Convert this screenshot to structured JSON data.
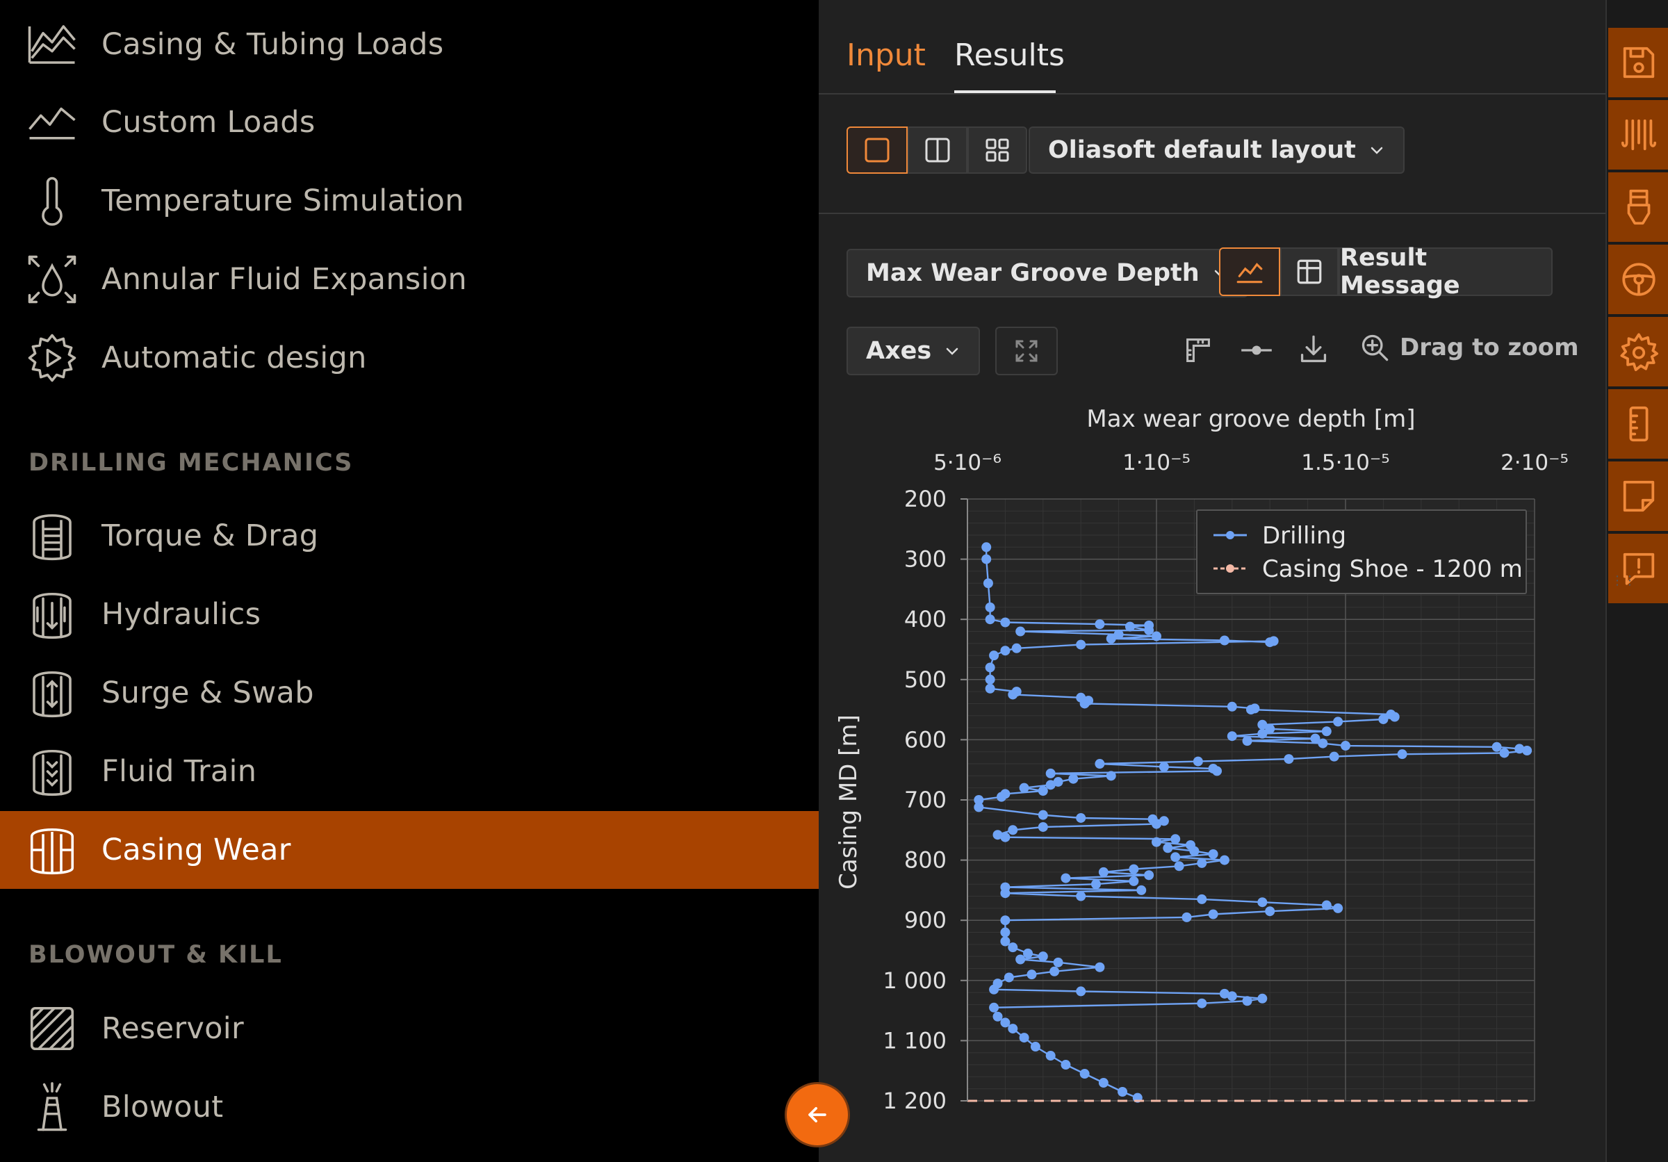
{
  "sidebar": {
    "items": [
      {
        "label": "Casing & Tubing Loads",
        "icon": "loads-chart-icon"
      },
      {
        "label": "Custom Loads",
        "icon": "line-chart-icon"
      },
      {
        "label": "Temperature Simulation",
        "icon": "thermometer-icon"
      },
      {
        "label": "Annular Fluid Expansion",
        "icon": "droplet-expand-icon"
      },
      {
        "label": "Automatic design",
        "icon": "gear-play-icon"
      }
    ],
    "sections": [
      {
        "title": "DRILLING MECHANICS",
        "items": [
          {
            "label": "Torque & Drag",
            "icon": "torque-drag-icon"
          },
          {
            "label": "Hydraulics",
            "icon": "hydraulics-icon"
          },
          {
            "label": "Surge & Swab",
            "icon": "surge-swab-icon"
          },
          {
            "label": "Fluid Train",
            "icon": "fluid-train-icon"
          },
          {
            "label": "Casing Wear",
            "icon": "casing-wear-icon",
            "active": true
          }
        ]
      },
      {
        "title": "BLOWOUT & KILL",
        "items": [
          {
            "label": "Reservoir",
            "icon": "hatched-square-icon"
          },
          {
            "label": "Blowout",
            "icon": "blowout-rig-icon"
          }
        ]
      }
    ]
  },
  "tabs": {
    "input": "Input",
    "results": "Results",
    "active": "results"
  },
  "layout": {
    "dropdown": "Oliasoft default layout"
  },
  "result_controls": {
    "metric": "Max Wear Groove Depth",
    "message_button": "Result Message",
    "axes": "Axes",
    "drag_zoom": "Drag to zoom"
  },
  "colors": {
    "accent": "#f0893a",
    "active_nav": "#a84300",
    "series_drilling": "#6fa3f5",
    "series_shoe": "#f4b9a6"
  },
  "chart_data": {
    "type": "line",
    "title": "",
    "xlabel": "Max wear groove depth [m]",
    "ylabel": "Casing MD [m]",
    "xlim": [
      5e-06,
      2e-05
    ],
    "ylim": [
      200,
      1200
    ],
    "x_ticks": [
      "5·10⁻⁶",
      "1·10⁻⁵",
      "1.5·10⁻⁵",
      "2·10⁻⁵"
    ],
    "y_ticks": [
      "200",
      "300",
      "400",
      "500",
      "600",
      "700",
      "800",
      "900",
      "1 000",
      "1 100",
      "1 200"
    ],
    "legend_position": "top-right",
    "grid": true,
    "series": [
      {
        "name": "Drilling",
        "points": [
          [
            5.5e-06,
            280
          ],
          [
            5.5e-06,
            300
          ],
          [
            5.55e-06,
            340
          ],
          [
            5.6e-06,
            380
          ],
          [
            5.6e-06,
            400
          ],
          [
            6e-06,
            405
          ],
          [
            8.5e-06,
            408
          ],
          [
            9.8e-06,
            410
          ],
          [
            9.3e-06,
            412
          ],
          [
            9.8e-06,
            418
          ],
          [
            6.4e-06,
            420
          ],
          [
            9e-06,
            425
          ],
          [
            1e-05,
            428
          ],
          [
            8.8e-06,
            432
          ],
          [
            1.18e-05,
            435
          ],
          [
            1.3e-05,
            438
          ],
          [
            1.31e-05,
            436
          ],
          [
            8e-06,
            442
          ],
          [
            6.3e-06,
            448
          ],
          [
            6e-06,
            452
          ],
          [
            5.7e-06,
            460
          ],
          [
            5.6e-06,
            480
          ],
          [
            5.6e-06,
            500
          ],
          [
            5.6e-06,
            515
          ],
          [
            6.3e-06,
            520
          ],
          [
            6.2e-06,
            525
          ],
          [
            8e-06,
            530
          ],
          [
            8.2e-06,
            535
          ],
          [
            8.1e-06,
            540
          ],
          [
            1.2e-05,
            545
          ],
          [
            1.26e-05,
            548
          ],
          [
            1.25e-05,
            550
          ],
          [
            1.62e-05,
            558
          ],
          [
            1.63e-05,
            562
          ],
          [
            1.6e-05,
            566
          ],
          [
            1.48e-05,
            570
          ],
          [
            1.28e-05,
            575
          ],
          [
            1.3e-05,
            582
          ],
          [
            1.45e-05,
            586
          ],
          [
            1.28e-05,
            590
          ],
          [
            1.2e-05,
            594
          ],
          [
            1.42e-05,
            598
          ],
          [
            1.24e-05,
            602
          ],
          [
            1.44e-05,
            606
          ],
          [
            1.5e-05,
            610
          ],
          [
            1.9e-05,
            612
          ],
          [
            1.96e-05,
            615
          ],
          [
            1.98e-05,
            618
          ],
          [
            1.92e-05,
            622
          ],
          [
            1.65e-05,
            624
          ],
          [
            1.47e-05,
            628
          ],
          [
            1.35e-05,
            632
          ],
          [
            1.11e-05,
            636
          ],
          [
            8.5e-06,
            640
          ],
          [
            1.02e-05,
            645
          ],
          [
            1.15e-05,
            648
          ],
          [
            1.16e-05,
            652
          ],
          [
            7.2e-06,
            656
          ],
          [
            8.8e-06,
            660
          ],
          [
            7.8e-06,
            665
          ],
          [
            7.4e-06,
            670
          ],
          [
            7.2e-06,
            675
          ],
          [
            6.5e-06,
            680
          ],
          [
            7e-06,
            685
          ],
          [
            6e-06,
            690
          ],
          [
            5.9e-06,
            695
          ],
          [
            5.3e-06,
            700
          ],
          [
            5.3e-06,
            712
          ],
          [
            7e-06,
            725
          ],
          [
            8e-06,
            730
          ],
          [
            9.9e-06,
            732
          ],
          [
            1.02e-05,
            735
          ],
          [
            1e-05,
            740
          ],
          [
            7e-06,
            745
          ],
          [
            6.2e-06,
            750
          ],
          [
            5.8e-06,
            758
          ],
          [
            6e-06,
            762
          ],
          [
            1.05e-05,
            765
          ],
          [
            1e-05,
            770
          ],
          [
            1.09e-05,
            775
          ],
          [
            1.03e-05,
            780
          ],
          [
            1.1e-05,
            785
          ],
          [
            1.15e-05,
            790
          ],
          [
            1.05e-05,
            795
          ],
          [
            1.18e-05,
            800
          ],
          [
            1.12e-05,
            805
          ],
          [
            1.06e-05,
            810
          ],
          [
            9.4e-06,
            815
          ],
          [
            8.6e-06,
            820
          ],
          [
            9.8e-06,
            825
          ],
          [
            7.6e-06,
            830
          ],
          [
            9.4e-06,
            835
          ],
          [
            8.4e-06,
            840
          ],
          [
            6e-06,
            845
          ],
          [
            9.6e-06,
            850
          ],
          [
            6e-06,
            855
          ],
          [
            8e-06,
            860
          ],
          [
            1.12e-05,
            865
          ],
          [
            1.28e-05,
            870
          ],
          [
            1.45e-05,
            875
          ],
          [
            1.48e-05,
            880
          ],
          [
            1.3e-05,
            885
          ],
          [
            1.15e-05,
            890
          ],
          [
            1.08e-05,
            895
          ],
          [
            6e-06,
            900
          ],
          [
            6e-06,
            920
          ],
          [
            6e-06,
            935
          ],
          [
            6.2e-06,
            945
          ],
          [
            6.6e-06,
            955
          ],
          [
            7e-06,
            960
          ],
          [
            6.4e-06,
            965
          ],
          [
            7.4e-06,
            970
          ],
          [
            8.5e-06,
            978
          ],
          [
            7.3e-06,
            985
          ],
          [
            6.7e-06,
            990
          ],
          [
            6.1e-06,
            995
          ],
          [
            5.8e-06,
            1005
          ],
          [
            5.7e-06,
            1015
          ],
          [
            8e-06,
            1018
          ],
          [
            1.18e-05,
            1022
          ],
          [
            1.2e-05,
            1026
          ],
          [
            1.28e-05,
            1030
          ],
          [
            1.24e-05,
            1034
          ],
          [
            1.12e-05,
            1038
          ],
          [
            5.7e-06,
            1045
          ],
          [
            5.8e-06,
            1060
          ],
          [
            6e-06,
            1070
          ],
          [
            6.2e-06,
            1080
          ],
          [
            6.5e-06,
            1095
          ],
          [
            6.8e-06,
            1110
          ],
          [
            7.2e-06,
            1125
          ],
          [
            7.6e-06,
            1140
          ],
          [
            8.1e-06,
            1155
          ],
          [
            8.6e-06,
            1170
          ],
          [
            9.1e-06,
            1185
          ],
          [
            9.5e-06,
            1195
          ]
        ]
      },
      {
        "name": "Casing Shoe - 1200 m",
        "points": [
          [
            5e-06,
            1200
          ],
          [
            2e-05,
            1200
          ]
        ]
      }
    ]
  }
}
